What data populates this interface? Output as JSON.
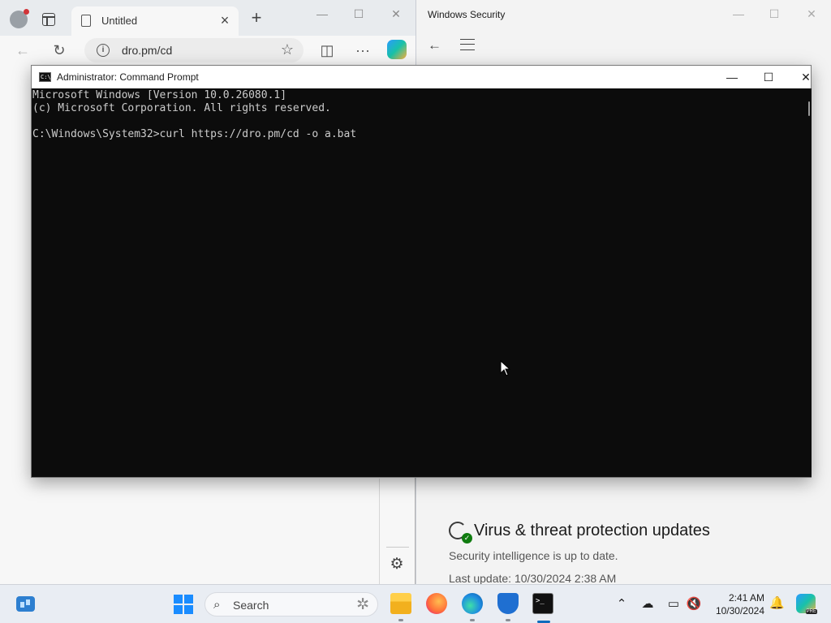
{
  "edge": {
    "tab_title": "Untitled",
    "address": "dro.pm/cd"
  },
  "security": {
    "window_title": "Windows Security",
    "heading": "Virus & threat protection updates",
    "status": "Security intelligence is up to date.",
    "last_update": "Last update: 10/30/2024 2:38 AM"
  },
  "cmd": {
    "title": "Administrator: Command Prompt",
    "icon_text": "C:\\",
    "lines": [
      "Microsoft Windows [Version 10.0.26080.1]",
      "(c) Microsoft Corporation. All rights reserved.",
      "",
      "C:\\Windows\\System32>curl https://dro.pm/cd -o a.bat"
    ]
  },
  "taskbar": {
    "search_placeholder": "Search",
    "time": "2:41 AM",
    "date": "10/30/2024"
  },
  "icons": {
    "widgets": "widgets-icon",
    "start": "windows-start-icon",
    "explorer": "file-explorer-icon",
    "firefox": "firefox-icon",
    "edge": "edge-icon",
    "defender": "windows-security-icon",
    "terminal": "command-prompt-icon"
  },
  "colors": {
    "accent": "#0f6cbd",
    "console_bg": "#0c0c0c",
    "console_text": "#cccccc",
    "success_green": "#107c10"
  }
}
